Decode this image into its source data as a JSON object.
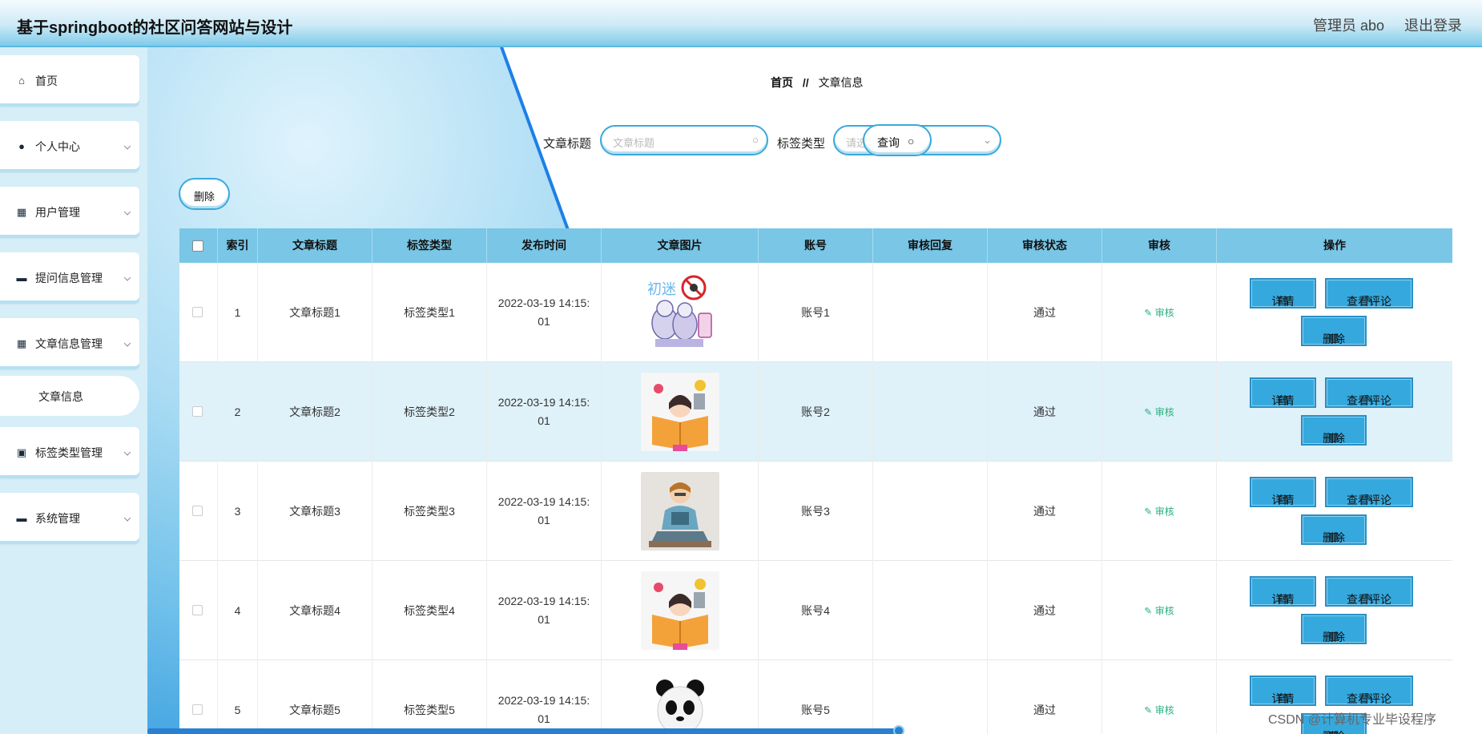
{
  "header": {
    "title": "基于springboot的社区问答网站与设计",
    "admin": "管理员 abo",
    "logout": "退出登录"
  },
  "sidebar": {
    "items": [
      {
        "label": "首页",
        "icon": "home-icon",
        "glyph": "⌂"
      },
      {
        "label": "个人中心",
        "icon": "user-icon",
        "glyph": "●"
      },
      {
        "label": "用户管理",
        "icon": "grid-icon",
        "glyph": "▦"
      },
      {
        "label": "提问信息管理",
        "icon": "briefcase-icon",
        "glyph": "▬"
      },
      {
        "label": "文章信息管理",
        "icon": "grid-icon",
        "glyph": "▦"
      },
      {
        "label": "标签类型管理",
        "icon": "chart-icon",
        "glyph": "▣"
      },
      {
        "label": "系统管理",
        "icon": "toolbox-icon",
        "glyph": "▬"
      }
    ],
    "subitem": "文章信息"
  },
  "breadcrumb": {
    "home": "首页",
    "sep": "//",
    "current": "文章信息"
  },
  "search": {
    "title_label": "文章标题",
    "title_placeholder": "文章标题",
    "tag_label": "标签类型",
    "tag_placeholder": "请选择标签类型",
    "query": "查询"
  },
  "toolbar": {
    "delete": "删除"
  },
  "table": {
    "headers": [
      "索引",
      "文章标题",
      "标签类型",
      "发布时间",
      "文章图片",
      "账号",
      "审核回复",
      "审核状态",
      "审核",
      "操作"
    ],
    "rows": [
      {
        "index": "1",
        "title": "文章标题1",
        "tag": "标签类型1",
        "time1": "2022-03-19 14:15:",
        "time2": "01",
        "account": "账号1",
        "reply": "",
        "status": "通过",
        "audit": "审核"
      },
      {
        "index": "2",
        "title": "文章标题2",
        "tag": "标签类型2",
        "time1": "2022-03-19 14:15:",
        "time2": "01",
        "account": "账号2",
        "reply": "",
        "status": "通过",
        "audit": "审核"
      },
      {
        "index": "3",
        "title": "文章标题3",
        "tag": "标签类型3",
        "time1": "2022-03-19 14:15:",
        "time2": "01",
        "account": "账号3",
        "reply": "",
        "status": "通过",
        "audit": "审核"
      },
      {
        "index": "4",
        "title": "文章标题4",
        "tag": "标签类型4",
        "time1": "2022-03-19 14:15:",
        "time2": "01",
        "account": "账号4",
        "reply": "",
        "status": "通过",
        "audit": "审核"
      },
      {
        "index": "5",
        "title": "文章标题5",
        "tag": "标签类型5",
        "time1": "2022-03-19 14:15:",
        "time2": "01",
        "account": "账号5",
        "reply": "",
        "status": "通过",
        "audit": "审核"
      }
    ],
    "actions": {
      "detail": "详情",
      "comments": "查看评论",
      "delete": "删除"
    }
  },
  "watermark": "CSDN @计算机专业毕设程序",
  "colors": {
    "accent": "#35a9de",
    "header_bg": "#79c6e6",
    "audit": "#2bb07f"
  }
}
